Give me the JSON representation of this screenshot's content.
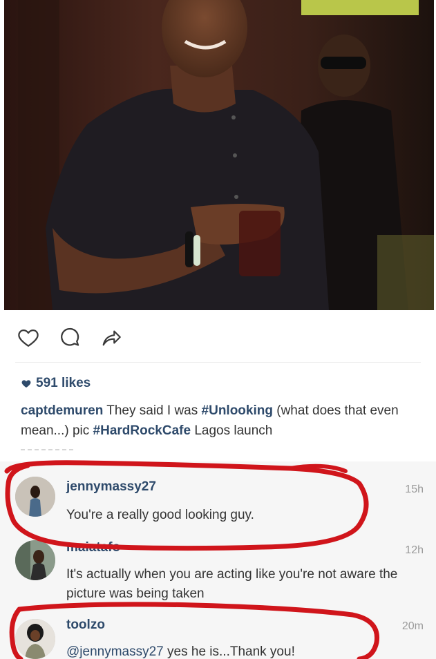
{
  "post": {
    "likes": "591 likes",
    "caption": {
      "username": "captdemuren",
      "text_before": " They said I was ",
      "tag1": "#Unlooking",
      "text_middle": " (what does that even mean...) pic ",
      "tag2": "#HardRockCafe",
      "text_after": " Lagos launch"
    }
  },
  "actions": {
    "like_icon": "heart-outline-icon",
    "comment_icon": "comment-bubble-icon",
    "share_icon": "share-arrow-icon"
  },
  "comments": [
    {
      "username": "jennymassy27",
      "time": "15h",
      "text": "You're a really good looking guy."
    },
    {
      "username": "maiatafo",
      "time": "12h",
      "text": "It's actually when you are acting like you're not aware the picture was being taken"
    },
    {
      "username": "toolzo",
      "time": "20m",
      "mention": "@jennymassy27",
      "text": " yes he is...Thank you!"
    }
  ],
  "colors": {
    "link_blue": "#2e4a6b",
    "annotation_red": "#d0151b",
    "timestamp_gray": "#9a9a9a"
  }
}
